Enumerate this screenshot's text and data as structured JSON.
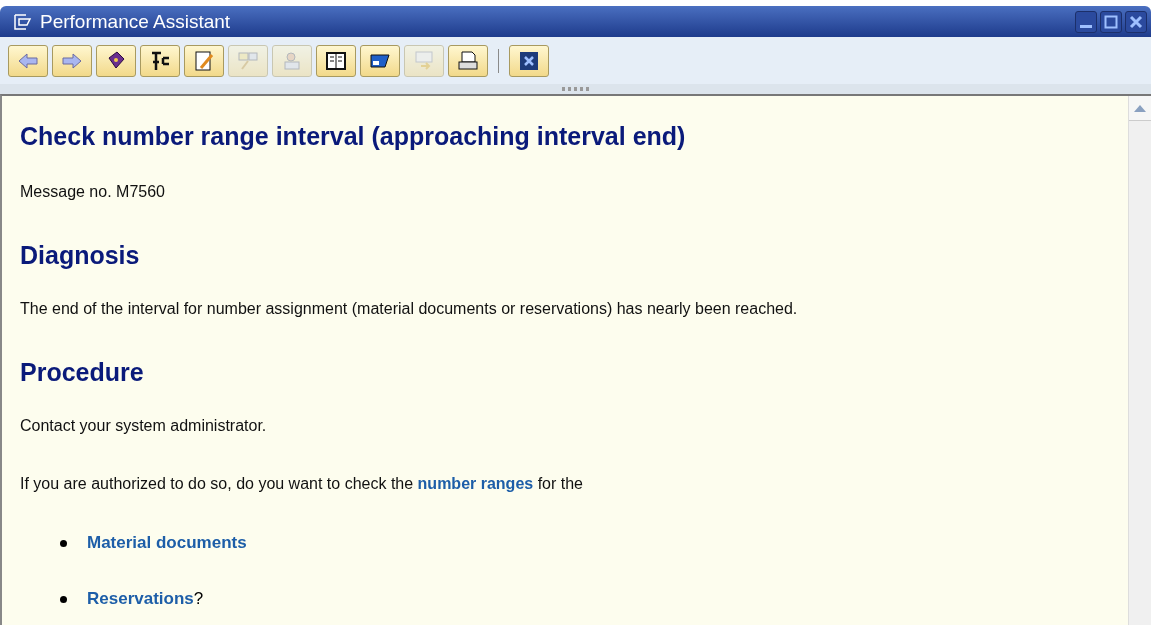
{
  "window": {
    "title": "Performance Assistant"
  },
  "toolbar": [
    {
      "disabled": false
    },
    {
      "disabled": false
    },
    {
      "disabled": false
    },
    {
      "disabled": false
    },
    {
      "disabled": false
    },
    {
      "disabled": true
    },
    {
      "disabled": true
    },
    {
      "disabled": false
    },
    {
      "disabled": false
    },
    {
      "disabled": true
    },
    {
      "disabled": false
    },
    {
      "disabled": false
    }
  ],
  "content": {
    "title": "Check number range interval (approaching interval end)",
    "message_no": "Message no. M7560",
    "sections": [
      {
        "heading": "Diagnosis",
        "paragraphs": [
          {
            "text": "The end of the interval for number assignment (material documents or reservations) has nearly been reached."
          }
        ]
      },
      {
        "heading": "Procedure",
        "paragraphs": [
          {
            "text": "Contact your system administrator."
          },
          {
            "text": "If you are authorized to do so, do you want to check the",
            "link": "number ranges",
            "after": "for the"
          }
        ],
        "bullets": [
          {
            "link": "Material documents"
          },
          {
            "link": "Reservations",
            "after": "?"
          }
        ]
      }
    ]
  }
}
